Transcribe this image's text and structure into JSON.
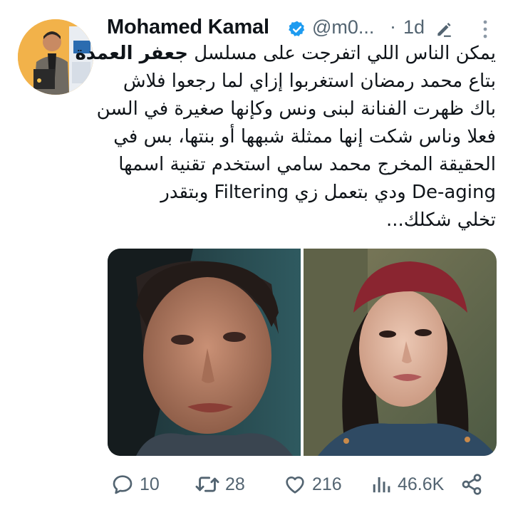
{
  "tweet": {
    "author_name": "Mohamed Kamal",
    "handle": "@m0...",
    "separator": "·",
    "time": "1d",
    "body_lines": [
      {
        "pre": "يمكن الناس اللي اتفرجت على مسلسل ",
        "bold": "جعفر العمدة",
        "post": ""
      },
      {
        "pre": "بتاع محمد رمضان استغربوا إزاي لما رجعوا فلاش",
        "bold": "",
        "post": ""
      },
      {
        "pre": "باك ظهرت الفنانة لبنى ونس وكإنها صغيرة في السن",
        "bold": "",
        "post": ""
      },
      {
        "pre": "فعلا وناس شكت إنها ممثلة شبهها أو بنتها، بس في",
        "bold": "",
        "post": ""
      },
      {
        "pre": "الحقيقة المخرج محمد سامي استخدم تقنية اسمها",
        "bold": "",
        "post": ""
      },
      {
        "pre": "De-aging ودي بتعمل زي Filtering وبتقدر",
        "bold": "",
        "post": ""
      },
      {
        "pre": "تخلي شكلك...",
        "bold": "",
        "post": ""
      }
    ]
  },
  "actions": {
    "replies": "10",
    "retweets": "28",
    "likes": "216",
    "views": "46.6K"
  },
  "colors": {
    "text": "#0f1419",
    "muted": "#536471",
    "verified": "#1d9bf0"
  },
  "icons": [
    "verified-badge-icon",
    "edit-pencil-icon",
    "more-options-icon",
    "reply-icon",
    "retweet-icon",
    "like-icon",
    "views-icon",
    "share-icon"
  ]
}
